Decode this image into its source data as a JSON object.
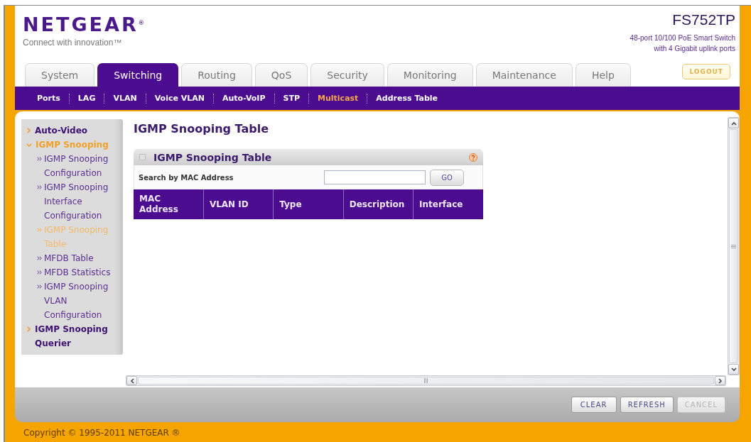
{
  "header": {
    "logo": "NETGEAR$^{®}$",
    "tagline": "Connect with innovation™",
    "model": "FS752TP",
    "description_lines": [
      "48-port 10/100 PoE Smart Switch",
      "with 4 Gigabit uplink ports"
    ]
  },
  "tabs": [
    {
      "label": "System",
      "selected": false
    },
    {
      "label": "Switching",
      "selected": true
    },
    {
      "label": "Routing",
      "selected": false
    },
    {
      "label": "QoS",
      "selected": false
    },
    {
      "label": "Security",
      "selected": false
    },
    {
      "label": "Monitoring",
      "selected": false
    },
    {
      "label": "Maintenance",
      "selected": false
    },
    {
      "label": "Help",
      "selected": false
    }
  ],
  "logout_button": "LOGOUT",
  "subnav": [
    {
      "label": "Ports",
      "selected": false
    },
    {
      "label": "LAG",
      "selected": false
    },
    {
      "label": "VLAN",
      "selected": false
    },
    {
      "label": "Voice VLAN",
      "selected": false
    },
    {
      "label": "Auto-VoIP",
      "selected": false
    },
    {
      "label": "STP",
      "selected": false
    },
    {
      "label": "Multicast",
      "selected": true
    },
    {
      "label": "Address Table",
      "selected": false
    }
  ],
  "sidebar": {
    "items": [
      {
        "label": "Auto-Video",
        "expanded": false,
        "selected": false
      },
      {
        "label": "IGMP Snooping",
        "expanded": true,
        "selected": true,
        "children": [
          {
            "label": "IGMP Snooping Configuration",
            "selected": false
          },
          {
            "label": "IGMP Snooping Interface Configuration",
            "selected": false
          },
          {
            "label": "IGMP Snooping Table",
            "selected": true
          },
          {
            "label": "MFDB Table",
            "selected": false
          },
          {
            "label": "MFDB Statistics",
            "selected": false
          },
          {
            "label": "IGMP Snooping VLAN Configuration",
            "selected": false
          }
        ]
      },
      {
        "label": "IGMP Snooping Querier",
        "expanded": false,
        "selected": false
      }
    ]
  },
  "page_title": "IGMP Snooping Table",
  "panel": {
    "title": "IGMP Snooping Table",
    "search": {
      "label": "Search by MAC Address",
      "button": "GO"
    },
    "table": {
      "columns": [
        "MAC Address",
        "VLAN ID",
        "Type",
        "Description",
        "Interface"
      ]
    }
  },
  "buttons": [
    {
      "label": "CLEAR",
      "disabled": false
    },
    {
      "label": "REFRESH",
      "disabled": false
    },
    {
      "label": "CANCEL",
      "disabled": true
    }
  ],
  "footer": "Copyright © 1995-2011 NETGEAR ®"
}
